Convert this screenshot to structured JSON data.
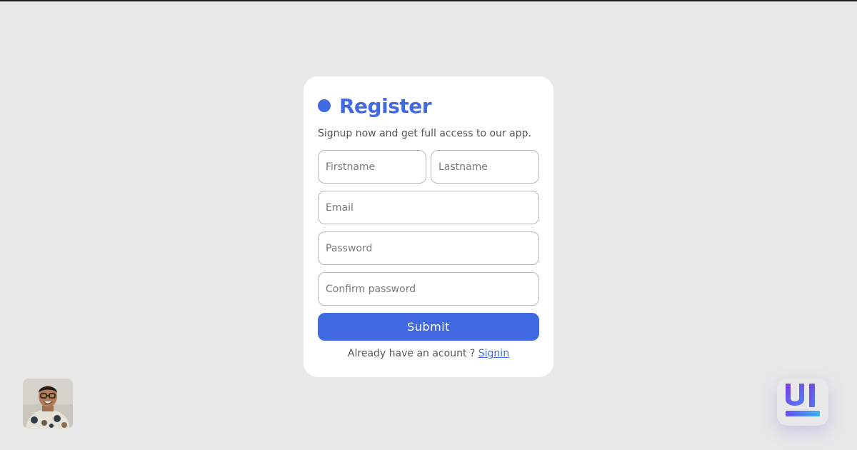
{
  "form": {
    "title": "Register",
    "subtitle": "Signup now and get full access to our app.",
    "firstname_placeholder": "Firstname",
    "lastname_placeholder": "Lastname",
    "email_placeholder": "Email",
    "password_placeholder": "Password",
    "confirm_password_placeholder": "Confirm password",
    "submit_label": "Submit",
    "signin_prompt": "Already have an acount ?",
    "signin_link": "Signin"
  },
  "colors": {
    "accent": "#4169e1",
    "background": "#e8e8e8",
    "card": "#ffffff"
  },
  "icons": {
    "title_marker": "dot-icon",
    "brand": "ui-logo-icon"
  }
}
